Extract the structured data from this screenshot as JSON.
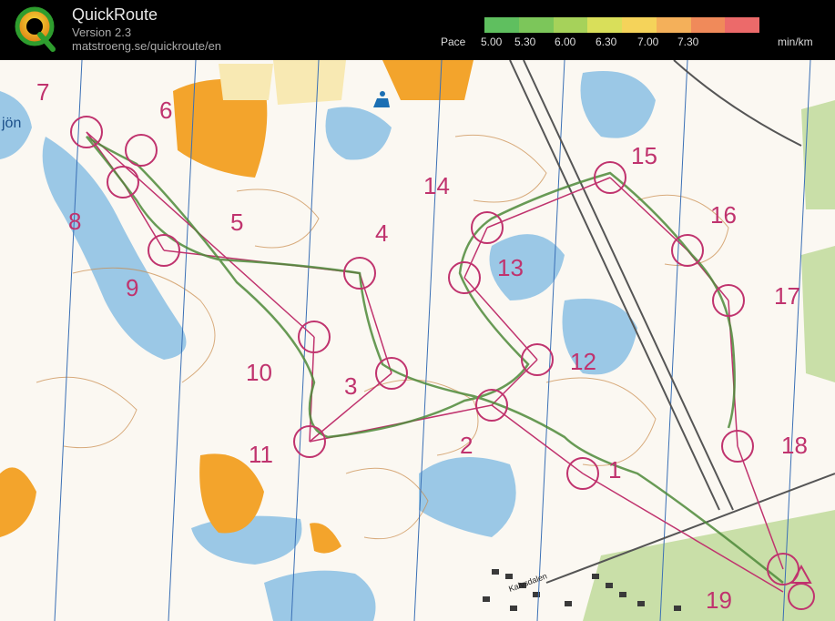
{
  "app": {
    "title": "QuickRoute",
    "version": "Version 2.3",
    "url": "matstroeng.se/quickroute/en"
  },
  "pace_legend": {
    "label": "Pace",
    "ticks": [
      "5.00",
      "5.30",
      "6.00",
      "6.30",
      "7.00",
      "7.30"
    ],
    "unit": "min/km",
    "colors": [
      "#5fbf5f",
      "#7cc65a",
      "#a6d25a",
      "#d9df5a",
      "#f5d35a",
      "#f4b05a",
      "#f08a5a",
      "#ec6a6a"
    ]
  },
  "map": {
    "route_color": "#4d8a3a",
    "course_color": "#c0336e",
    "water_color": "#9bc8e6",
    "open_land_color": "#f3a42c",
    "controls": [
      {
        "label": "1"
      },
      {
        "label": "2"
      },
      {
        "label": "3"
      },
      {
        "label": "4"
      },
      {
        "label": "5"
      },
      {
        "label": "6"
      },
      {
        "label": "7"
      },
      {
        "label": "8"
      },
      {
        "label": "9"
      },
      {
        "label": "10"
      },
      {
        "label": "11"
      },
      {
        "label": "12"
      },
      {
        "label": "13"
      },
      {
        "label": "14"
      },
      {
        "label": "15"
      },
      {
        "label": "16"
      },
      {
        "label": "17"
      },
      {
        "label": "18"
      },
      {
        "label": "19"
      }
    ],
    "place_labels": [
      "jön",
      "Kalvsdalen"
    ]
  }
}
